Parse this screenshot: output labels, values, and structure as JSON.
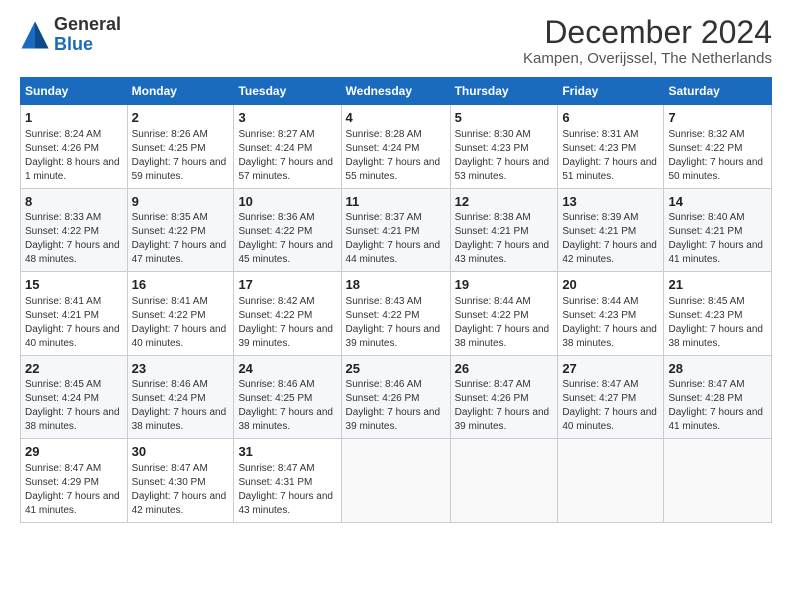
{
  "header": {
    "logo_general": "General",
    "logo_blue": "Blue",
    "title": "December 2024",
    "subtitle": "Kampen, Overijssel, The Netherlands"
  },
  "calendar": {
    "days_of_week": [
      "Sunday",
      "Monday",
      "Tuesday",
      "Wednesday",
      "Thursday",
      "Friday",
      "Saturday"
    ],
    "weeks": [
      [
        {
          "day": "1",
          "sunrise": "8:24 AM",
          "sunset": "4:26 PM",
          "daylight": "8 hours and 1 minute."
        },
        {
          "day": "2",
          "sunrise": "8:26 AM",
          "sunset": "4:25 PM",
          "daylight": "7 hours and 59 minutes."
        },
        {
          "day": "3",
          "sunrise": "8:27 AM",
          "sunset": "4:24 PM",
          "daylight": "7 hours and 57 minutes."
        },
        {
          "day": "4",
          "sunrise": "8:28 AM",
          "sunset": "4:24 PM",
          "daylight": "7 hours and 55 minutes."
        },
        {
          "day": "5",
          "sunrise": "8:30 AM",
          "sunset": "4:23 PM",
          "daylight": "7 hours and 53 minutes."
        },
        {
          "day": "6",
          "sunrise": "8:31 AM",
          "sunset": "4:23 PM",
          "daylight": "7 hours and 51 minutes."
        },
        {
          "day": "7",
          "sunrise": "8:32 AM",
          "sunset": "4:22 PM",
          "daylight": "7 hours and 50 minutes."
        }
      ],
      [
        {
          "day": "8",
          "sunrise": "8:33 AM",
          "sunset": "4:22 PM",
          "daylight": "7 hours and 48 minutes."
        },
        {
          "day": "9",
          "sunrise": "8:35 AM",
          "sunset": "4:22 PM",
          "daylight": "7 hours and 47 minutes."
        },
        {
          "day": "10",
          "sunrise": "8:36 AM",
          "sunset": "4:22 PM",
          "daylight": "7 hours and 45 minutes."
        },
        {
          "day": "11",
          "sunrise": "8:37 AM",
          "sunset": "4:21 PM",
          "daylight": "7 hours and 44 minutes."
        },
        {
          "day": "12",
          "sunrise": "8:38 AM",
          "sunset": "4:21 PM",
          "daylight": "7 hours and 43 minutes."
        },
        {
          "day": "13",
          "sunrise": "8:39 AM",
          "sunset": "4:21 PM",
          "daylight": "7 hours and 42 minutes."
        },
        {
          "day": "14",
          "sunrise": "8:40 AM",
          "sunset": "4:21 PM",
          "daylight": "7 hours and 41 minutes."
        }
      ],
      [
        {
          "day": "15",
          "sunrise": "8:41 AM",
          "sunset": "4:21 PM",
          "daylight": "7 hours and 40 minutes."
        },
        {
          "day": "16",
          "sunrise": "8:41 AM",
          "sunset": "4:22 PM",
          "daylight": "7 hours and 40 minutes."
        },
        {
          "day": "17",
          "sunrise": "8:42 AM",
          "sunset": "4:22 PM",
          "daylight": "7 hours and 39 minutes."
        },
        {
          "day": "18",
          "sunrise": "8:43 AM",
          "sunset": "4:22 PM",
          "daylight": "7 hours and 39 minutes."
        },
        {
          "day": "19",
          "sunrise": "8:44 AM",
          "sunset": "4:22 PM",
          "daylight": "7 hours and 38 minutes."
        },
        {
          "day": "20",
          "sunrise": "8:44 AM",
          "sunset": "4:23 PM",
          "daylight": "7 hours and 38 minutes."
        },
        {
          "day": "21",
          "sunrise": "8:45 AM",
          "sunset": "4:23 PM",
          "daylight": "7 hours and 38 minutes."
        }
      ],
      [
        {
          "day": "22",
          "sunrise": "8:45 AM",
          "sunset": "4:24 PM",
          "daylight": "7 hours and 38 minutes."
        },
        {
          "day": "23",
          "sunrise": "8:46 AM",
          "sunset": "4:24 PM",
          "daylight": "7 hours and 38 minutes."
        },
        {
          "day": "24",
          "sunrise": "8:46 AM",
          "sunset": "4:25 PM",
          "daylight": "7 hours and 38 minutes."
        },
        {
          "day": "25",
          "sunrise": "8:46 AM",
          "sunset": "4:26 PM",
          "daylight": "7 hours and 39 minutes."
        },
        {
          "day": "26",
          "sunrise": "8:47 AM",
          "sunset": "4:26 PM",
          "daylight": "7 hours and 39 minutes."
        },
        {
          "day": "27",
          "sunrise": "8:47 AM",
          "sunset": "4:27 PM",
          "daylight": "7 hours and 40 minutes."
        },
        {
          "day": "28",
          "sunrise": "8:47 AM",
          "sunset": "4:28 PM",
          "daylight": "7 hours and 41 minutes."
        }
      ],
      [
        {
          "day": "29",
          "sunrise": "8:47 AM",
          "sunset": "4:29 PM",
          "daylight": "7 hours and 41 minutes."
        },
        {
          "day": "30",
          "sunrise": "8:47 AM",
          "sunset": "4:30 PM",
          "daylight": "7 hours and 42 minutes."
        },
        {
          "day": "31",
          "sunrise": "8:47 AM",
          "sunset": "4:31 PM",
          "daylight": "7 hours and 43 minutes."
        },
        null,
        null,
        null,
        null
      ]
    ]
  }
}
